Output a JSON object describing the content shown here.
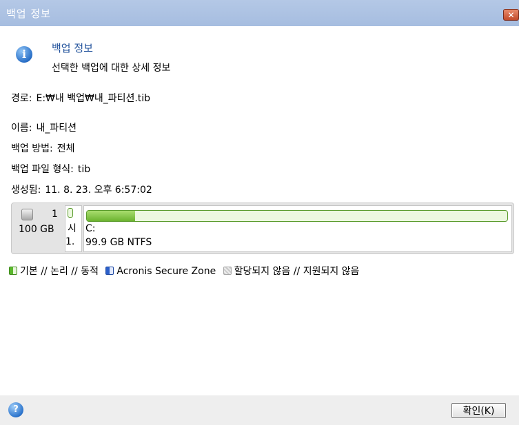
{
  "window": {
    "title": "백업 정보",
    "close_label": "✕"
  },
  "header": {
    "title": "백업 정보",
    "subtitle": "선택한 백업에 대한 상세 정보"
  },
  "details": {
    "path_label": "경로:",
    "path_value": "E:₩내 백업₩내_파티션.tib",
    "name_label": "이름:",
    "name_value": "내_파티션",
    "method_label": "백업 방법:",
    "method_value": "전체",
    "format_label": "백업 파일 형식:",
    "format_value": "tib",
    "created_label": "생성됨:",
    "created_value": "11. 8. 23. 오후 6:57:02"
  },
  "disk": {
    "number": "1",
    "size": "100 GB",
    "partitions": [
      {
        "line1": "시",
        "line2": "1.",
        "fill_fraction": 1.0
      },
      {
        "line1": "C:",
        "line2": "99.9 GB  NTFS",
        "fill_fraction": 0.115
      }
    ]
  },
  "legend": {
    "basic": "기본 // 논리 // 동적",
    "zone": "Acronis Secure Zone",
    "unallocated": "할당되지 않음 // 지원되지 않음"
  },
  "footer": {
    "ok_label": "확인(K)",
    "help_label": "?"
  }
}
